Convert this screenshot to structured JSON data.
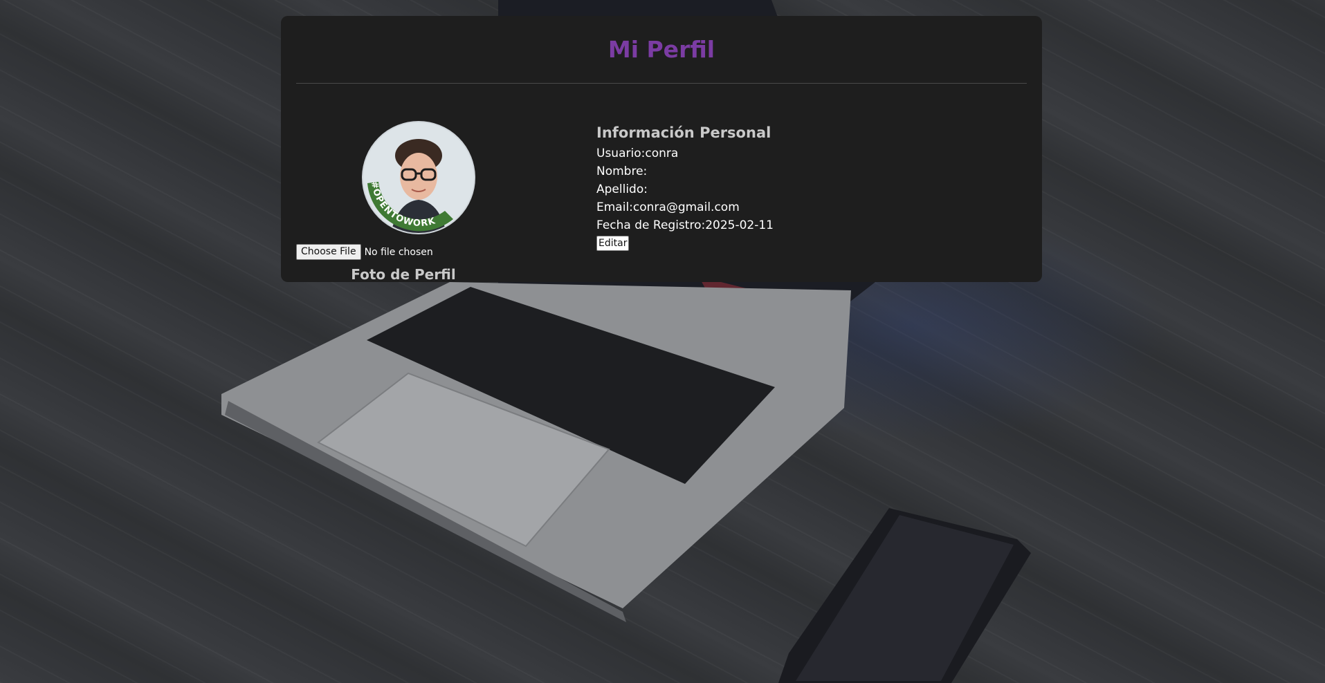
{
  "page": {
    "title": "Mi Perfil",
    "accent_color": "#7b3ca3",
    "card_color": "#1e1e1e"
  },
  "photo": {
    "badge_text": "#OPENTOWORK",
    "file_button_label": "Choose File",
    "file_status": "No file chosen",
    "section_label": "Foto de Perfil"
  },
  "info": {
    "heading": "Información Personal",
    "fields": [
      {
        "label": "Usuario:",
        "value": "conra"
      },
      {
        "label": "Nombre:",
        "value": ""
      },
      {
        "label": "Apellido:",
        "value": ""
      },
      {
        "label": "Email:",
        "value": "conra@gmail.com"
      },
      {
        "label": "Fecha de Registro:",
        "value": "2025-02-11"
      }
    ],
    "edit_button_label": "Editar"
  }
}
